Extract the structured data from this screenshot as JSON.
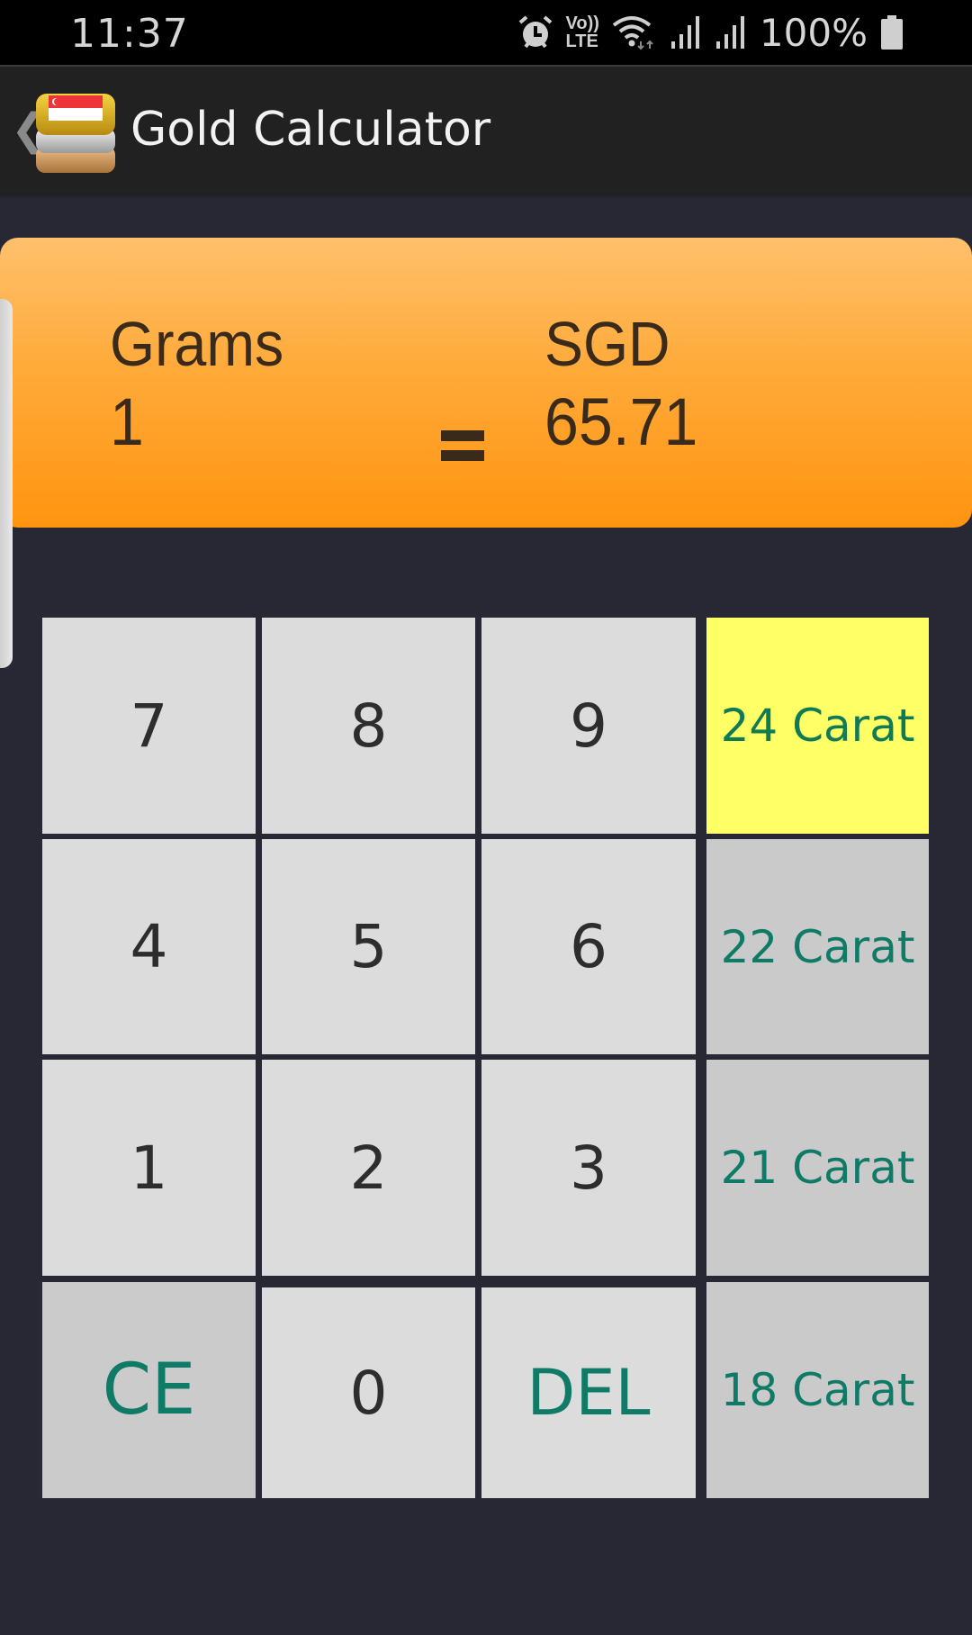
{
  "status_bar": {
    "time": "11:37",
    "icons": [
      "alarm-icon",
      "volte-icon",
      "wifi-icon",
      "signal-icon",
      "signal-icon"
    ],
    "volte_label_top": "Vo))",
    "volte_label_bottom": "LTE",
    "battery_percent": "100%"
  },
  "app_bar": {
    "back_glyph": "❮",
    "logo_icon": "gold-silver-bronze-bars-singapore-flag-icon",
    "title": "Gold Calculator"
  },
  "result": {
    "from_unit": "Grams",
    "from_value": "1",
    "equals": "=",
    "to_unit": "SGD",
    "to_value": "65.71"
  },
  "keypad": {
    "rows": [
      [
        "7",
        "8",
        "9",
        "24 Carat"
      ],
      [
        "4",
        "5",
        "6",
        "22 Carat"
      ],
      [
        "1",
        "2",
        "3",
        "21 Carat"
      ],
      [
        "CE",
        "0",
        "DEL",
        "18 Carat"
      ]
    ],
    "selected_carat": "24 Carat"
  },
  "colors": {
    "background": "#282834",
    "result_gradient_top": "#ffc06c",
    "result_gradient_bottom": "#ff9410",
    "key": "#dcdcdc",
    "carat_key": "#cacaca",
    "selected_carat": "#ffff66",
    "accent_text": "#0f7a66"
  }
}
